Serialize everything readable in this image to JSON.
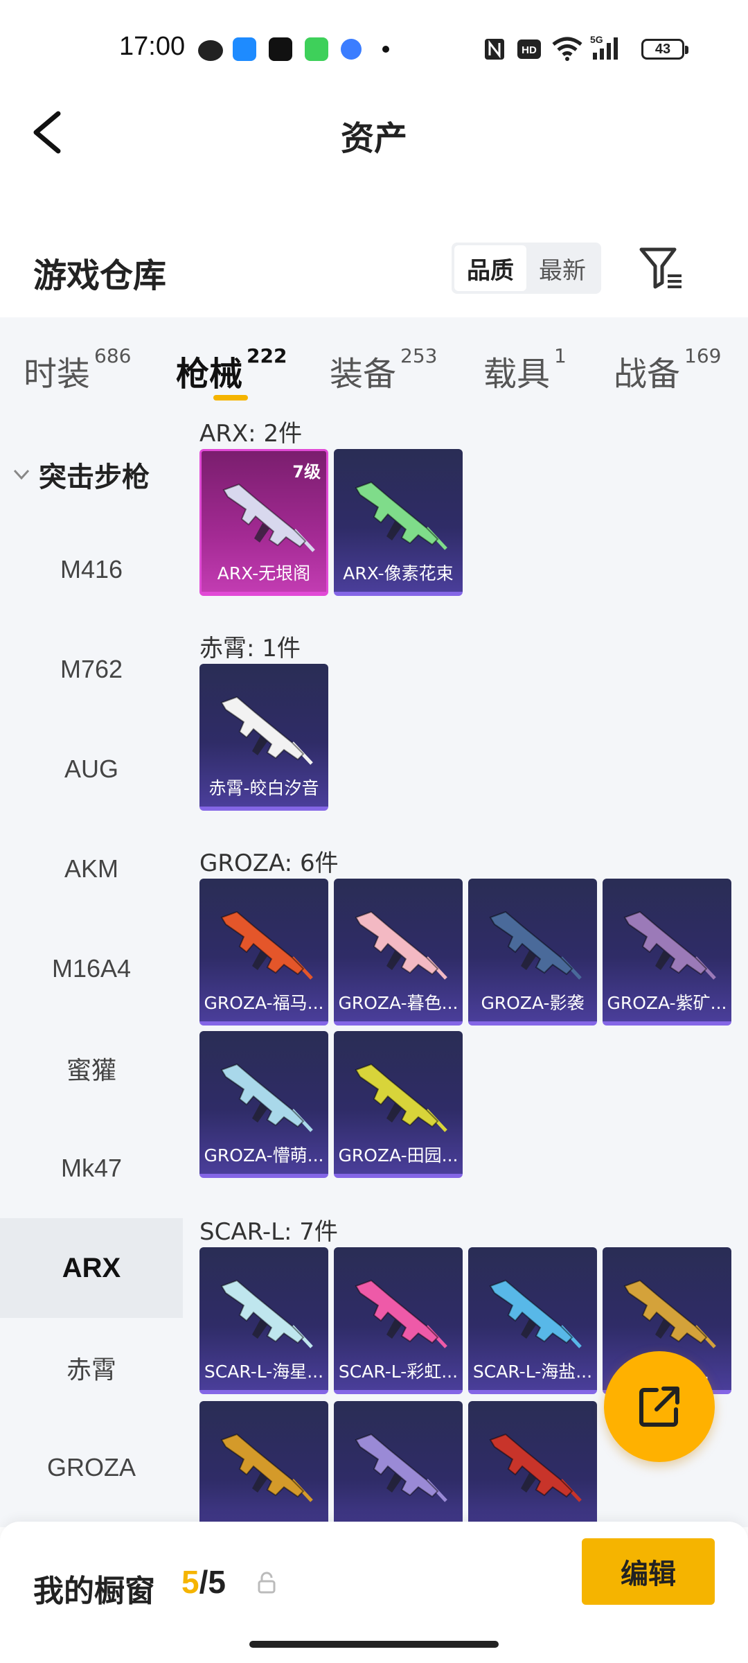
{
  "status_bar": {
    "time": "17:00",
    "battery": "43"
  },
  "header": {
    "title": "资产"
  },
  "warehouse": {
    "title": "游戏仓库",
    "sort_options": [
      "品质",
      "最新"
    ],
    "active_sort": "品质"
  },
  "tabs": [
    {
      "label": "时装",
      "count": "686"
    },
    {
      "label": "枪械",
      "count": "222",
      "active": true
    },
    {
      "label": "装备",
      "count": "253"
    },
    {
      "label": "载具",
      "count": "1"
    },
    {
      "label": "战备",
      "count": "169"
    }
  ],
  "sidebar": {
    "group": "突击步枪",
    "items": [
      "M416",
      "M762",
      "AUG",
      "AKM",
      "M16A4",
      "蜜獾",
      "Mk47",
      "ARX",
      "赤霄",
      "GROZA"
    ],
    "active": "ARX"
  },
  "groups": [
    {
      "title": "ARX: 2件",
      "items": [
        {
          "name": "ARX-无垠阁",
          "level": "7级",
          "rarity": "legend",
          "color": "#d8d8ee"
        },
        {
          "name": "ARX-像素花束",
          "rarity": "epic",
          "color": "#7fdc8a"
        }
      ]
    },
    {
      "title": "赤霄: 1件",
      "items": [
        {
          "name": "赤霄-皎白汐音",
          "rarity": "epic",
          "color": "#f2f2f2"
        }
      ]
    },
    {
      "title": "GROZA: 6件",
      "items": [
        {
          "name": "GROZA-福马...",
          "rarity": "epic",
          "color": "#e4562a"
        },
        {
          "name": "GROZA-暮色...",
          "rarity": "epic",
          "color": "#f3b9c3"
        },
        {
          "name": "GROZA-影袭",
          "rarity": "epic",
          "color": "#4a6a9a"
        },
        {
          "name": "GROZA-紫矿...",
          "rarity": "epic",
          "color": "#9b7ab8"
        },
        {
          "name": "GROZA-懵萌...",
          "rarity": "epic",
          "color": "#a9d8ea"
        },
        {
          "name": "GROZA-田园...",
          "rarity": "epic",
          "color": "#d8d43a"
        }
      ]
    },
    {
      "title": "SCAR-L: 7件",
      "items": [
        {
          "name": "SCAR-L-海星...",
          "rarity": "epic",
          "color": "#bfe6ee"
        },
        {
          "name": "SCAR-L-彩虹...",
          "rarity": "epic",
          "color": "#ee5aa8"
        },
        {
          "name": "SCAR-L-海盐...",
          "rarity": "epic",
          "color": "#58b8e8"
        },
        {
          "name": "SCAR-L-...",
          "rarity": "epic",
          "color": "#d4a23a"
        },
        {
          "name": "",
          "rarity": "epic",
          "color": "#d49a2a"
        },
        {
          "name": "",
          "rarity": "epic",
          "color": "#9a8ad6"
        },
        {
          "name": "",
          "rarity": "epic",
          "color": "#c8342a"
        }
      ]
    }
  ],
  "showcase": {
    "label": "我的橱窗",
    "current": "5",
    "total": "/5"
  },
  "edit_label": "编辑"
}
